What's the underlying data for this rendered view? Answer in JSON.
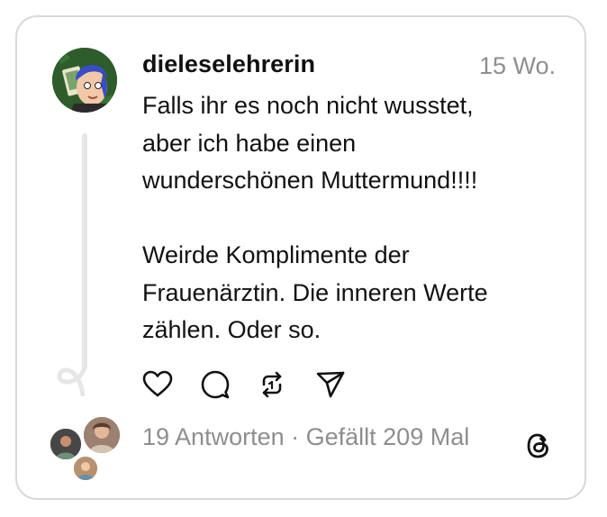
{
  "post": {
    "username": "dieleselehrerin",
    "timestamp": "15 Wo.",
    "text": "Falls ihr es noch nicht wusstet,\naber ich habe einen\nwunderschönen Muttermund!!!!\n\nWeirde Komplimente der\nFrauenärztin. Die inneren Werte\nzählen. Oder so."
  },
  "actions": {
    "icons": [
      "heart-icon",
      "comment-icon",
      "repost-icon",
      "share-icon"
    ]
  },
  "footer": {
    "replies": "19 Antworten",
    "separator": " · ",
    "likes": "Gefällt 209 Mal"
  },
  "colors": {
    "text": "#111111",
    "muted": "#8e8e8e",
    "border": "#d9d9d9",
    "thread_line": "#e6e6e6"
  }
}
